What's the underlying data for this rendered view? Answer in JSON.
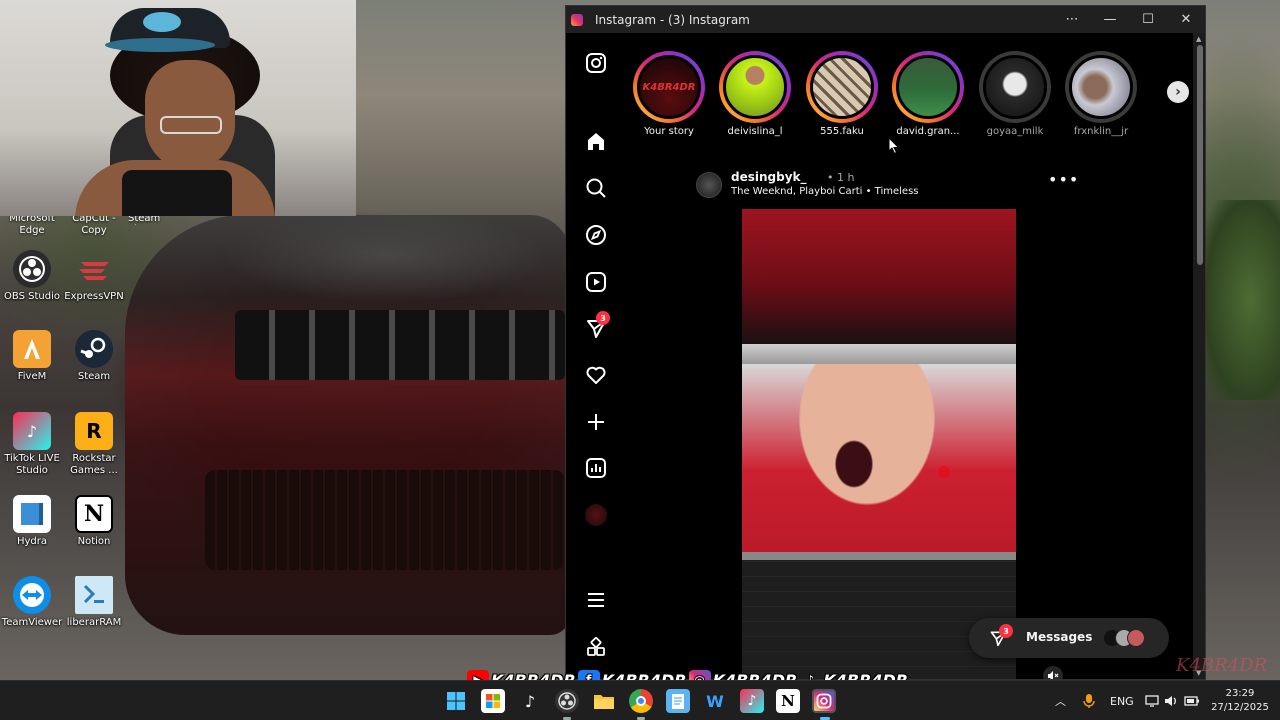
{
  "window": {
    "title": "Instagram - (3) Instagram",
    "controls": [
      "more-options",
      "minimize",
      "maximize",
      "close"
    ]
  },
  "desktop": {
    "cut_labels": [
      "Microsoft Edge",
      "CapCut - Copy",
      "Steam Player"
    ],
    "icons": [
      {
        "label": "OBS Studio",
        "icon": "obs-icon",
        "color": "#2b2b2b"
      },
      {
        "label": "ExpressVPN",
        "icon": "expressvpn-icon",
        "color": "#da3940"
      },
      {
        "label": "FiveM",
        "icon": "fivem-icon",
        "color": "#f4a236"
      },
      {
        "label": "Steam",
        "icon": "steam-icon",
        "color": "#1b2838"
      },
      {
        "label": "TikTok LIVE Studio",
        "icon": "tiktok-live-icon",
        "color": "#fe2c55"
      },
      {
        "label": "Rockstar Games ...",
        "icon": "rockstar-icon",
        "color": "#fcaf17"
      },
      {
        "label": "Hydra",
        "icon": "hydra-icon",
        "color": "#3a8fd6"
      },
      {
        "label": "Notion",
        "icon": "notion-icon",
        "color": "#ffffff"
      },
      {
        "label": "TeamViewer",
        "icon": "teamviewer-icon",
        "color": "#0e8ee9"
      },
      {
        "label": "liberarRAM",
        "icon": "script-file-icon",
        "color": "#cfe8f7"
      }
    ]
  },
  "sidebar": {
    "items": [
      {
        "name": "instagram-logo-icon"
      },
      {
        "name": "home-icon"
      },
      {
        "name": "search-icon"
      },
      {
        "name": "explore-icon"
      },
      {
        "name": "reels-icon"
      },
      {
        "name": "messages-icon",
        "badge": "3"
      },
      {
        "name": "notifications-icon"
      },
      {
        "name": "create-icon"
      },
      {
        "name": "dashboard-icon"
      },
      {
        "name": "profile-icon"
      },
      {
        "name": "more-menu-icon"
      },
      {
        "name": "also-from-meta-icon"
      }
    ]
  },
  "stories": [
    {
      "name": "Your story",
      "seen": false,
      "avatar_text": "K4BR4DR"
    },
    {
      "name": "deivislina_l",
      "seen": false
    },
    {
      "name": "555.faku",
      "seen": false
    },
    {
      "name": "david.gran...",
      "seen": false
    },
    {
      "name": "goyaa_milk",
      "seen": true
    },
    {
      "name": "frxnklin__jr",
      "seen": true
    }
  ],
  "post": {
    "username": "desingbyk_",
    "time": "• 1 h",
    "music": "The Weeknd, Playboi Carti • Timeless"
  },
  "messages": {
    "label": "Messages",
    "badge": "3"
  },
  "watermark": {
    "handles": [
      "K4BR4DR",
      "K4BR4DR",
      "K4BR4DR",
      "K4BR4DR"
    ],
    "corner_signature": "K4BR4DR"
  },
  "taskbar": {
    "language": "ENG",
    "time": "23:29",
    "date": "27/12/2025",
    "apps": [
      "start-icon",
      "store-icon",
      "tiktok-icon",
      "obs-icon",
      "file-explorer-icon",
      "chrome-icon",
      "notepad-icon",
      "waves-icon",
      "tiktok-live-icon",
      "notion-icon",
      "instagram-icon"
    ]
  },
  "colors": {
    "instagram_bg": "#000000",
    "badge_red": "#ff3040",
    "story_ring": "#d62976"
  }
}
